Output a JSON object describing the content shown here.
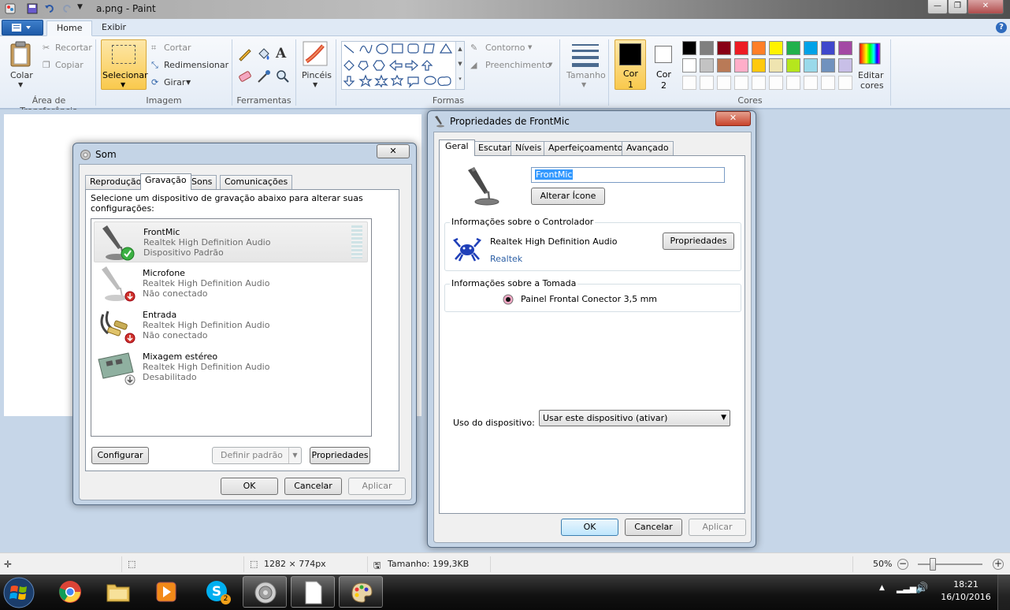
{
  "paint": {
    "window_title": "a.png - Paint",
    "tabs": {
      "home": "Home",
      "view": "Exibir"
    },
    "clipboard": {
      "paste": "Colar",
      "cut": "Recortar",
      "copy": "Copiar",
      "group": "Área de Transferência"
    },
    "image": {
      "select": "Selecionar",
      "crop": "Cortar",
      "resize": "Redimensionar",
      "rotate": "Girar",
      "group": "Imagem"
    },
    "tools_group": "Ferramentas",
    "brushes": "Pincéis",
    "shapes": {
      "outline": "Contorno",
      "fill": "Preenchimento",
      "group": "Formas"
    },
    "size": "Tamanho",
    "color1": {
      "label": "Cor",
      "num": "1"
    },
    "color2": {
      "label": "Cor",
      "num": "2"
    },
    "edit_colors": {
      "line1": "Editar",
      "line2": "cores"
    },
    "colors_group": "Cores",
    "palette_row1": [
      "#000000",
      "#7f7f7f",
      "#880015",
      "#ed1c24",
      "#ff7f27",
      "#fff200",
      "#22b14c",
      "#00a2e8",
      "#3f48cc",
      "#a349a4"
    ],
    "palette_row2": [
      "#ffffff",
      "#c3c3c3",
      "#b97a57",
      "#ffaec9",
      "#ffc90e",
      "#efe4b0",
      "#b5e61d",
      "#99d9ea",
      "#7092be",
      "#c8bfe7"
    ],
    "status": {
      "dimensions": "1282 × 774px",
      "size": "Tamanho: 199,3KB",
      "zoom": "50%"
    }
  },
  "som": {
    "title": "Som",
    "close": "✕",
    "tabs": [
      "Reprodução",
      "Gravação",
      "Sons",
      "Comunicações"
    ],
    "instruction": "Selecione um dispositivo de gravação abaixo para alterar suas configurações:",
    "devices": [
      {
        "name": "FrontMic",
        "driver": "Realtek High Definition Audio",
        "status": "Dispositivo Padrão"
      },
      {
        "name": "Microfone",
        "driver": "Realtek High Definition Audio",
        "status": "Não conectado"
      },
      {
        "name": "Entrada",
        "driver": "Realtek High Definition Audio",
        "status": "Não conectado"
      },
      {
        "name": "Mixagem estéreo",
        "driver": "Realtek High Definition Audio",
        "status": "Desabilitado"
      }
    ],
    "configure": "Configurar",
    "set_default": "Definir padrão",
    "properties": "Propriedades",
    "ok": "OK",
    "cancel": "Cancelar",
    "apply": "Aplicar"
  },
  "props": {
    "title": "Propriedades de FrontMic",
    "close": "✕",
    "tabs": [
      "Geral",
      "Escutar",
      "Níveis",
      "Aperfeiçoamentos",
      "Avançado"
    ],
    "device_name": "FrontMic",
    "change_icon": "Alterar Ícone",
    "controller_group": "Informações sobre o Controlador",
    "controller_name": "Realtek High Definition Audio",
    "controller_vendor": "Realtek",
    "properties_btn": "Propriedades",
    "jack_group": "Informações sobre a Tomada",
    "jack_name": "Painel Frontal Conector 3,5 mm",
    "usage_label": "Uso do dispositivo:",
    "usage_value": "Usar este dispositivo (ativar)",
    "ok": "OK",
    "cancel": "Cancelar",
    "apply": "Aplicar"
  },
  "taskbar": {
    "time": "18:21",
    "date": "16/10/2016",
    "skype_badge": "2"
  }
}
